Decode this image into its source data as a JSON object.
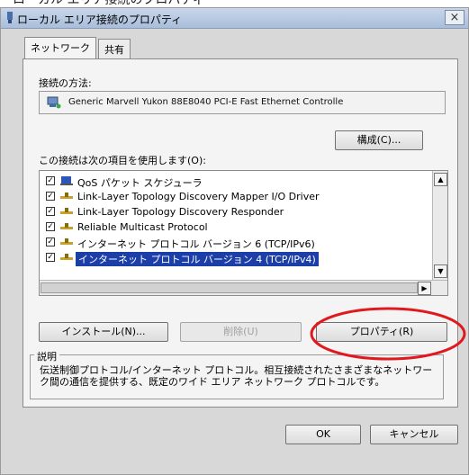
{
  "window": {
    "title": "ローカル エリア接続のプロパティ",
    "close_label": "×"
  },
  "tabs": [
    {
      "label": "ネットワーク"
    },
    {
      "label": "共有"
    }
  ],
  "connection": {
    "method_label": "接続の方法:",
    "adapter_name": "Generic Marvell Yukon 88E8040 PCI-E Fast Ethernet Controlle",
    "configure_button": "構成(C)..."
  },
  "items_label": "この接続は次の項目を使用します(O):",
  "items": [
    {
      "label": "QoS パケット スケジューラ",
      "checked": true,
      "icon": "qos-scheduler-icon"
    },
    {
      "label": "Link-Layer Topology Discovery Mapper I/O Driver",
      "checked": true,
      "icon": "protocol-icon"
    },
    {
      "label": "Link-Layer Topology Discovery Responder",
      "checked": true,
      "icon": "protocol-icon"
    },
    {
      "label": "Reliable Multicast Protocol",
      "checked": true,
      "icon": "protocol-icon"
    },
    {
      "label": "インターネット プロトコル バージョン 6 (TCP/IPv6)",
      "checked": true,
      "icon": "protocol-icon"
    },
    {
      "label": "インターネット プロトコル バージョン 4 (TCP/IPv4)",
      "checked": true,
      "icon": "protocol-icon",
      "selected": true
    }
  ],
  "buttons": {
    "install": "インストール(N)...",
    "uninstall": "削除(U)",
    "properties": "プロパティ(R)"
  },
  "description": {
    "title": "説明",
    "text": "伝送制御プロトコル/インターネット プロトコル。相互接続されたさまざまなネットワーク間の通信を提供する、既定のワイド エリア ネットワーク プロトコルです。"
  },
  "dialog_buttons": {
    "ok": "OK",
    "cancel": "キャンセル"
  },
  "annotation": {
    "color": "#e0191e"
  },
  "colors": {
    "selection": "#1b3ea8",
    "titlebar": "#b9cbe4"
  }
}
